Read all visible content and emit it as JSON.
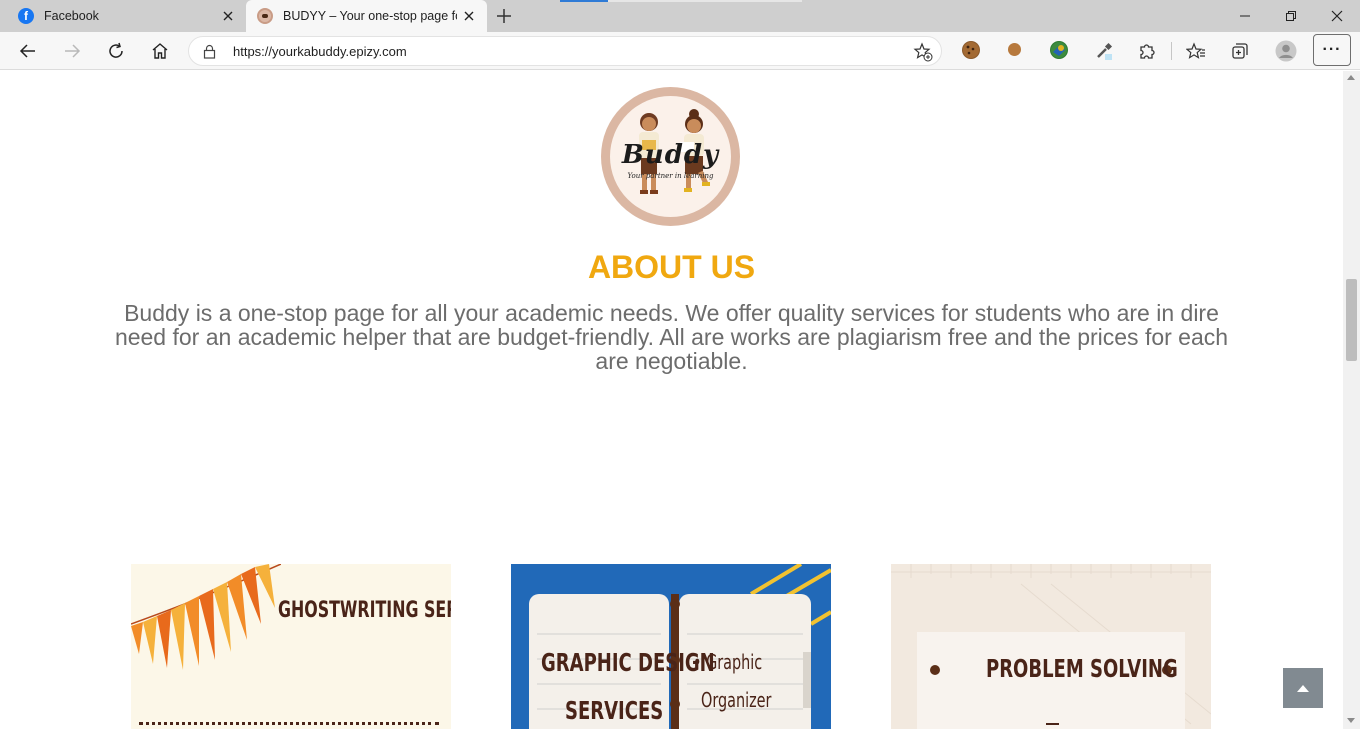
{
  "browser": {
    "tabs": [
      {
        "title": "Facebook",
        "favicon": "facebook-icon"
      },
      {
        "title": "BUDYY – Your one-stop page for",
        "favicon": "buddy-logo-icon",
        "active": true
      }
    ],
    "address_url": "https://yourkabuddy.epizy.com",
    "extensions": [
      "cookie-icon",
      "cookie-small-icon",
      "gem-icon",
      "eyedropper-icon",
      "puzzle-icon"
    ],
    "accent": "#2f7bd6"
  },
  "page": {
    "logo": {
      "name": "Buddy",
      "tagline": "Your partner in learning"
    },
    "about": {
      "title": "ABOUT US",
      "title_color": "#f0a810",
      "text": "Buddy is a one-stop page for all your academic needs. We offer quality services for students who are in dire need for an academic helper that are budget-friendly. All are works are plagiarism free and the prices for each are negotiable."
    },
    "services": [
      {
        "title": "GHOSTWRITING SERVICES"
      },
      {
        "title": "GRAPHIC DESIGN",
        "title2": "SERVICES",
        "items": [
          "• Graphic",
          "Organizer"
        ]
      },
      {
        "title": "PROBLEM SOLVING"
      }
    ]
  }
}
